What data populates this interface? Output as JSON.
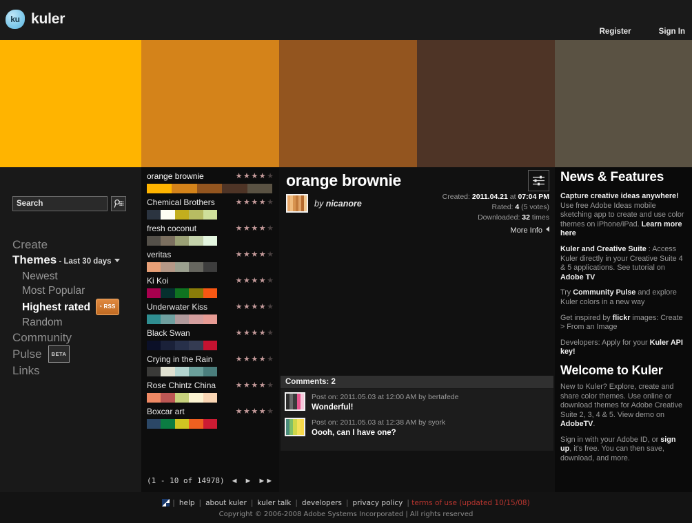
{
  "header": {
    "logo_badge": "ku",
    "logo_text": "kuler",
    "register": "Register",
    "sign_in": "Sign In"
  },
  "banner": {
    "bands": [
      "#ffb400",
      "#d4831a",
      "#93551f",
      "#4e3426",
      "#5a5243"
    ]
  },
  "sidebar": {
    "search_placeholder": "Search",
    "search_value": "",
    "search_icon": "search-keypad-icon",
    "items": [
      {
        "label": "Create",
        "style": "top"
      },
      {
        "label": "Themes",
        "style": "strong",
        "filter": "- Last 30 days",
        "caret": true
      },
      {
        "label": "Newest",
        "style": "sub"
      },
      {
        "label": "Most Popular",
        "style": "sub"
      },
      {
        "label": "Highest rated",
        "style": "sub-active",
        "rss": "RSS"
      },
      {
        "label": "Random",
        "style": "sub"
      },
      {
        "label": "Community",
        "style": "top"
      },
      {
        "label": "Pulse",
        "style": "top",
        "beta": "BETA"
      },
      {
        "label": "Links",
        "style": "top"
      }
    ]
  },
  "theme_list": {
    "themes": [
      {
        "name": "orange brownie",
        "rating": 4,
        "selected": true,
        "colors": [
          "#ffb400",
          "#d4831a",
          "#93551f",
          "#4e3426",
          "#5a5243"
        ]
      },
      {
        "name": "Chemical Brothers",
        "rating": 4,
        "selected": false,
        "colors": [
          "#2b3440",
          "#fdfdf3",
          "#c2ae1e",
          "#b7bc62",
          "#cfe09a"
        ]
      },
      {
        "name": "fresh coconut",
        "rating": 4,
        "selected": false,
        "colors": [
          "#545049",
          "#7b6f5f",
          "#9aa075",
          "#c4d2ab",
          "#e3f5df"
        ]
      },
      {
        "name": "veritas",
        "rating": 4,
        "selected": false,
        "colors": [
          "#e8a077",
          "#b59887",
          "#9ba08f",
          "#66665f",
          "#3d3d3d"
        ]
      },
      {
        "name": "Ki Koi",
        "rating": 4,
        "selected": false,
        "colors": [
          "#a8004e",
          "#05302e",
          "#0f7320",
          "#8a7c09",
          "#f75713"
        ]
      },
      {
        "name": "Underwater Kiss",
        "rating": 4,
        "selected": false,
        "colors": [
          "#2f8e91",
          "#6fa0a0",
          "#b09a9c",
          "#d49e9e",
          "#e79b94"
        ]
      },
      {
        "name": "Black Swan",
        "rating": 4,
        "selected": false,
        "colors": [
          "#0b1028",
          "#1a2139",
          "#27304a",
          "#343b52",
          "#c41230"
        ]
      },
      {
        "name": "Crying in the Rain",
        "rating": 4,
        "selected": false,
        "colors": [
          "#3a3a38",
          "#dfe0d0",
          "#b2d4cf",
          "#6ba09b",
          "#4a7e7d"
        ]
      },
      {
        "name": "Rose Chintz China",
        "rating": 4,
        "selected": false,
        "colors": [
          "#ef8964",
          "#bd5754",
          "#c8d27d",
          "#fdf4d2",
          "#fad6b4"
        ]
      },
      {
        "name": "Boxcar art",
        "rating": 4,
        "selected": false,
        "colors": [
          "#2b4766",
          "#0b7c42",
          "#cfc422",
          "#ef6020",
          "#cc1b33"
        ]
      }
    ],
    "pager_text": "(1 - 10 of 14978)",
    "pager_prev": "◄",
    "pager_next": "►",
    "pager_last": "►►"
  },
  "detail": {
    "title": "orange brownie",
    "sliders_icon": "sliders-icon",
    "by_prefix": "by",
    "author": "nicanore",
    "thumb_colors": [
      "#e8a86a",
      "#f0bc7e",
      "#d89450",
      "#c27b3c",
      "#e0a468",
      "#b56a2e",
      "#f2c890"
    ],
    "created_label": "Created:",
    "created_date": "2011.04.21",
    "created_at_word": "at",
    "created_time": "07:04 PM",
    "rated_label": "Rated:",
    "rated_value": "4",
    "rated_votes": "(5 votes)",
    "downloaded_label": "Downloaded:",
    "downloaded_value": "32",
    "downloaded_suffix": "times",
    "more_info": "More Info"
  },
  "comments": {
    "heading": "Comments: 2",
    "list": [
      {
        "meta": "Post on: 2011.05.03 at 12:00 AM by bertafede",
        "text": "Wonderful!",
        "thumb_colors": [
          "#2c2c2c",
          "#6a6a6a",
          "#3a3a3a",
          "#e8568f",
          "#f6c9db"
        ]
      },
      {
        "meta": "Post on: 2011.05.03 at 12:38 AM by syork",
        "text": "Oooh, can I have one?",
        "thumb_colors": [
          "#4a8a7a",
          "#7fbf6a",
          "#cfd84a",
          "#f4e05a",
          "#f7d84a"
        ]
      }
    ]
  },
  "news": {
    "title": "News & Features",
    "blocks": [
      {
        "bold_lead": "Capture creative ideas anywhere!",
        "body": " Use free Adobe Ideas mobile sketching app to create and use color themes on iPhone/iPad. ",
        "link": "Learn more here"
      },
      {
        "bold_lead": "Kuler and Creative Suite",
        "body": " : Access Kuler directly in your Creative Suite 4 & 5 applications. See tutorial on ",
        "link": "Adobe TV"
      },
      {
        "pre": "Try ",
        "bold_lead": "Community Pulse",
        "body": " and explore Kuler colors in a new way",
        "link": ""
      },
      {
        "pre": "Get inspired by ",
        "bold_lead": "flickr",
        "body": " images: Create > From an Image",
        "link": ""
      },
      {
        "pre": "Developers: Apply for your ",
        "bold_lead": "Kuler API key!",
        "body": "",
        "link": ""
      }
    ],
    "welcome_title": "Welcome to Kuler",
    "welcome_p1_a": "New to Kuler? Explore, create and share color themes. Use online or download themes for Adobe Creative Suite 2, 3, 4 & 5. View demo on ",
    "welcome_p1_b": "AdobeTV",
    "welcome_p1_c": ".",
    "welcome_p2_a": "Sign in with your Adobe ID, or ",
    "welcome_p2_b": "sign up",
    "welcome_p2_c": ", it's free. You can then save, download, and more."
  },
  "footer": {
    "mark": "adobe-mark-icon",
    "links": [
      "help",
      "about kuler",
      "kuler talk",
      "developers",
      "privacy policy"
    ],
    "terms": "terms of use (updated 10/15/08)",
    "copyright": "Copyright © 2006-2008 Adobe Systems Incorporated | All rights reserved"
  }
}
